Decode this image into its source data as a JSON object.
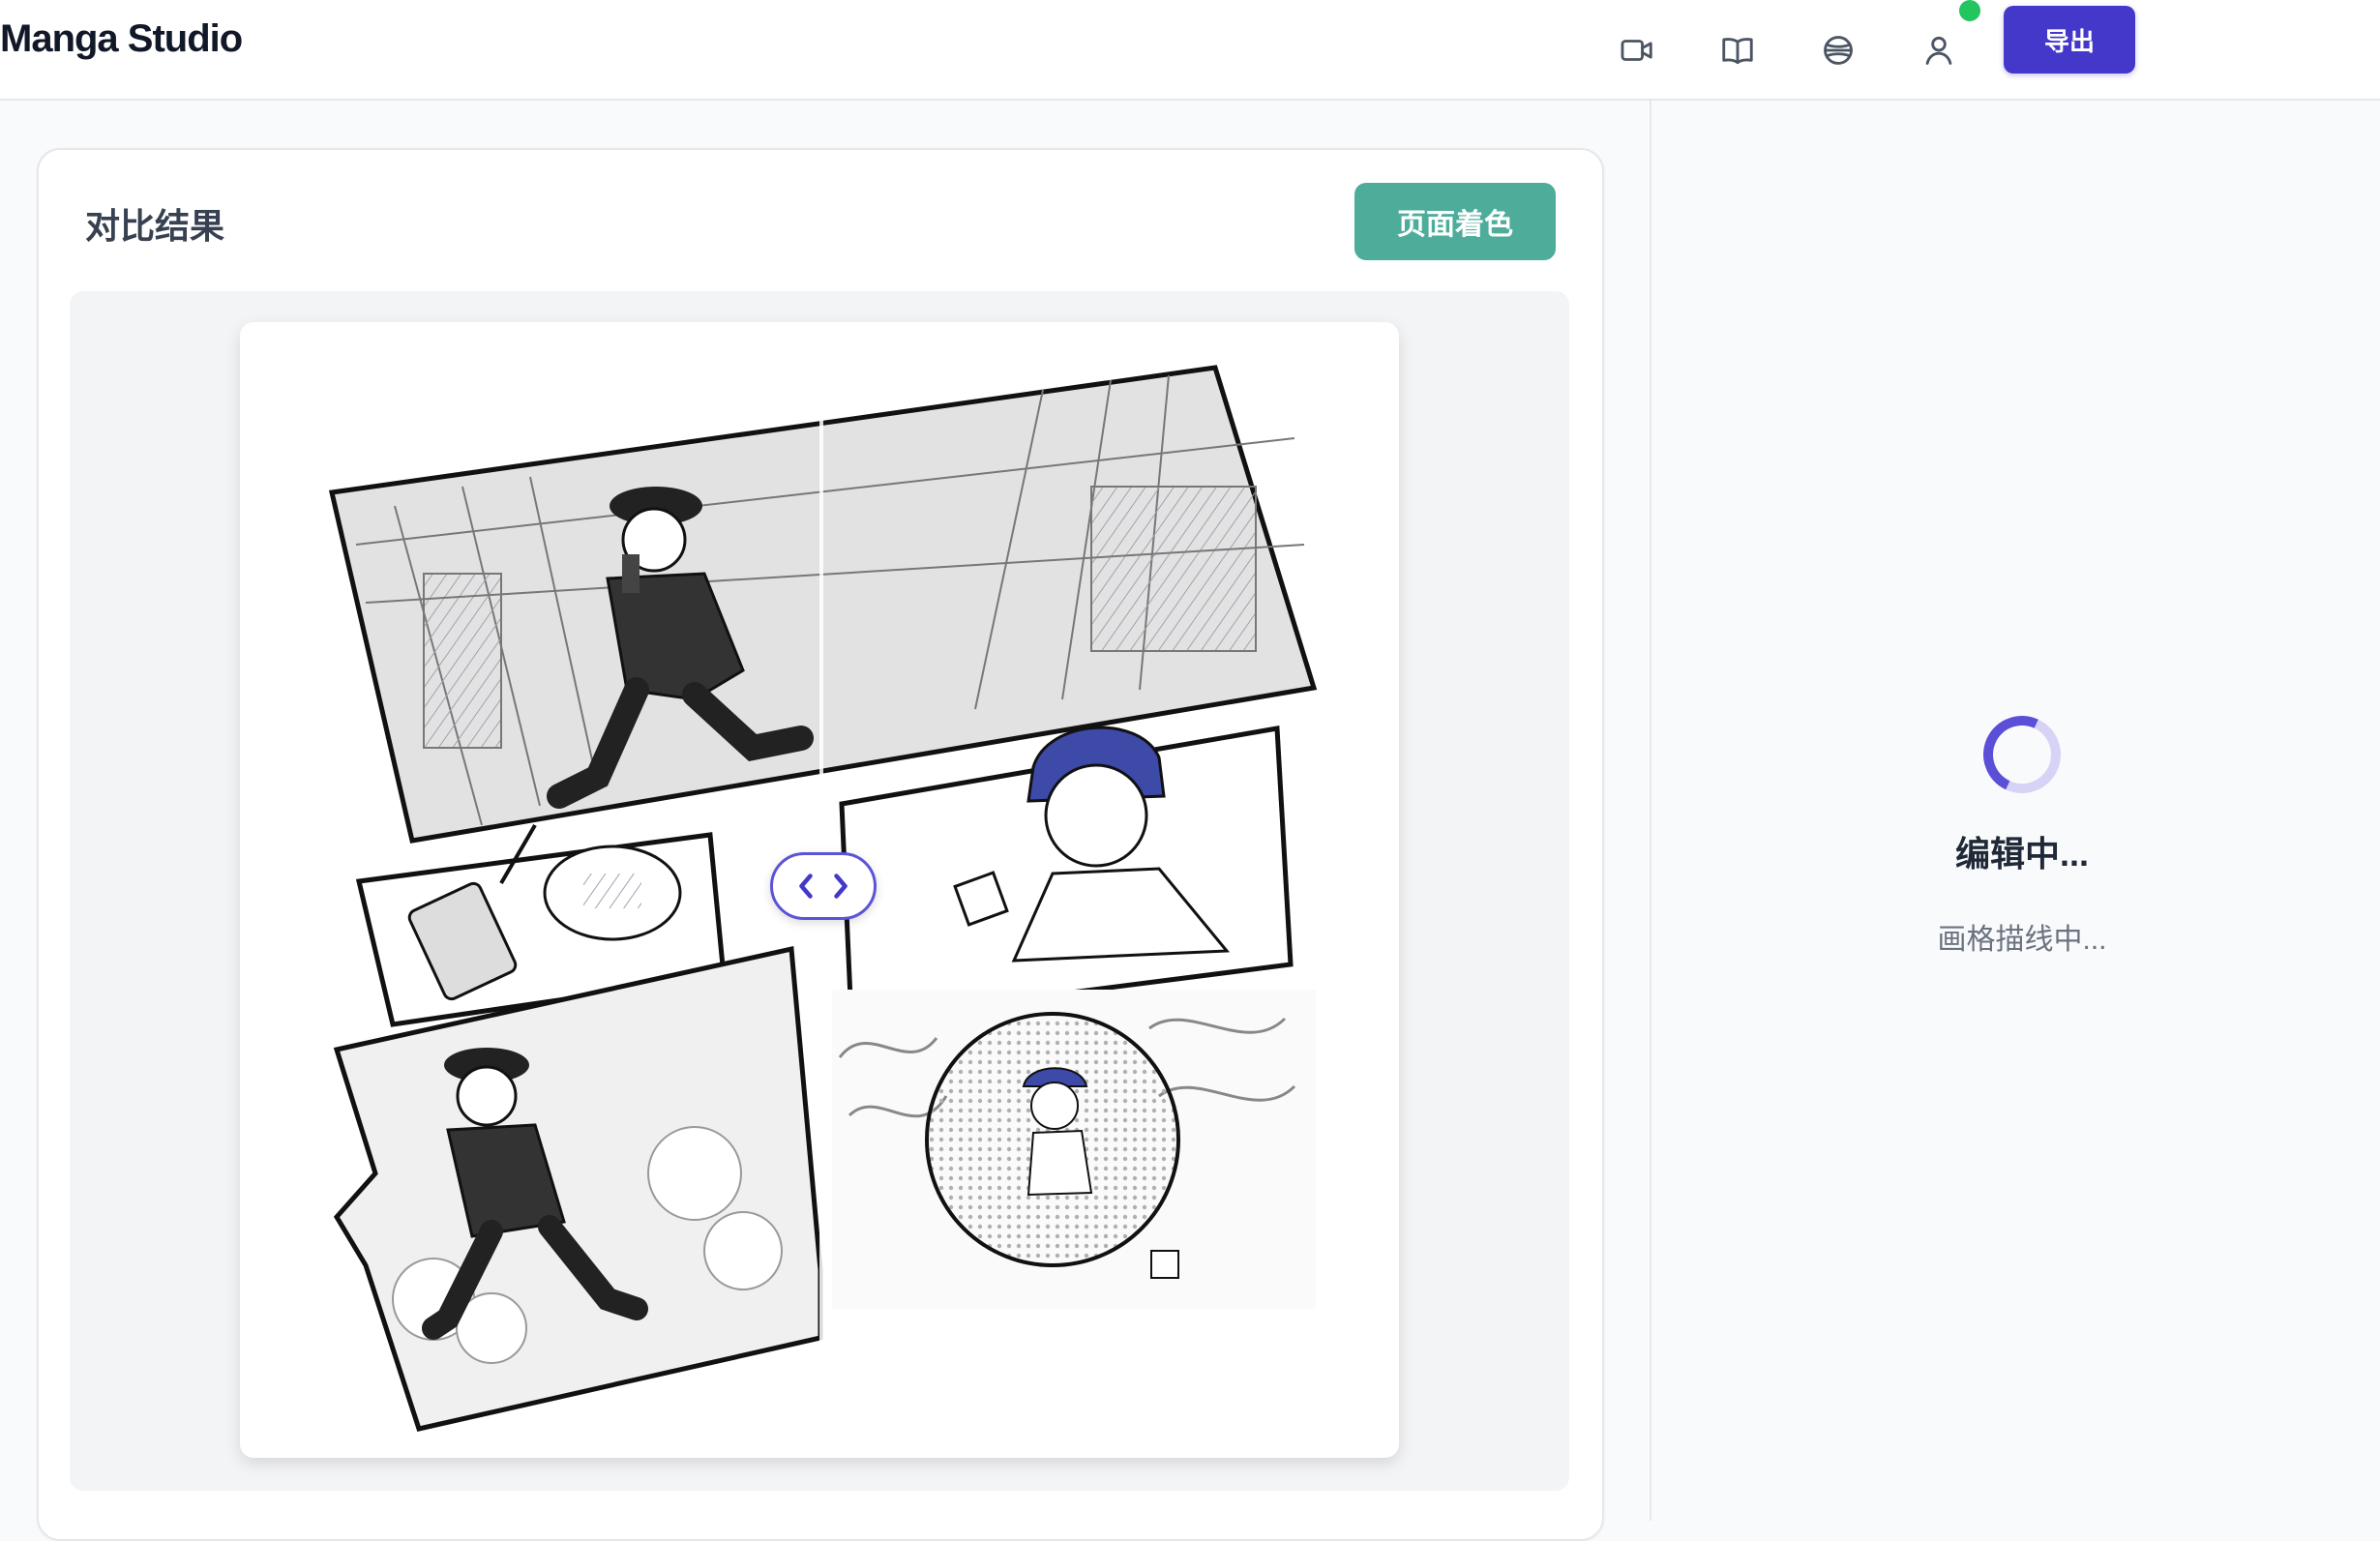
{
  "header": {
    "app_title": "Manga Studio",
    "icons": [
      "video-icon",
      "book-icon",
      "globe-icon",
      "user-icon"
    ],
    "status_color": "#22c55e",
    "export_label": "导出",
    "export_color": "#4338ca"
  },
  "card": {
    "title": "对比结果",
    "colorize_label": "页面着色",
    "colorize_color": "#4ead9a",
    "slider_icons": [
      "chevron-left-icon",
      "chevron-right-icon"
    ]
  },
  "side_panel": {
    "status_title": "编辑中...",
    "status_subtitle": "画格描线中...",
    "accent_color": "#5b4fd8"
  }
}
